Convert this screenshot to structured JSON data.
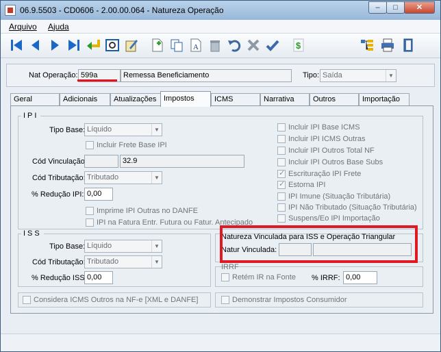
{
  "window": {
    "title": "06.9.5503 - CD0606 - 2.00.00.064 - Natureza Operação",
    "minimize": "–",
    "maximize": "□",
    "close": "✕"
  },
  "menu": [
    "Arquivo",
    "Ajuda"
  ],
  "toolbar": {
    "icons": [
      "first-icon",
      "prev-icon",
      "next-icon",
      "last-icon",
      "return-icon",
      "zoom-icon",
      "edit-icon",
      "new-icon",
      "copy-icon",
      "text-icon",
      "delete-icon",
      "undo-icon",
      "cancel-icon",
      "confirm-icon",
      "money-icon",
      "tree-icon",
      "print-icon",
      "exit-icon"
    ]
  },
  "header": {
    "nat_label": "Nat Operação:",
    "nat_value": "599a",
    "nat_desc": "Remessa Beneficiamento",
    "tipo_label": "Tipo:",
    "tipo_value": "Saída"
  },
  "tabs": [
    "Geral",
    "Adicionais",
    "Atualizações",
    "Impostos",
    "ICMS",
    "Narrativa",
    "Outros",
    "Importação"
  ],
  "ipi": {
    "title": "IPI",
    "tipo_base_label": "Tipo Base:",
    "tipo_base_value": "Líquido",
    "incluir_frete": "Incluir Frete Base IPI",
    "cod_vinc_label": "Cód Vinculação:",
    "cod_vinc_value": "32.9",
    "cod_trib_label": "Cód Tributação:",
    "cod_trib_value": "Tributado",
    "reducao_label": "% Redução IPI:",
    "reducao_value": "0,00",
    "imprime": "Imprime IPI Outras no DANFE",
    "ipi_fatura": "IPI na Fatura Entr. Futura ou Fatur. Antecipado",
    "right_checks": [
      "Incluir IPI Base ICMS",
      "Incluir IPI ICMS Outras",
      "Incluir IPI Outros Total NF",
      "Incluir IPI Outros Base Subs",
      "Escrituração IPI Frete",
      "Estorna IPI",
      "IPI Imune (Situação Tributária)",
      "IPI Não Tributado (Situação Tributária)",
      "Suspens/Eo IPI Importação"
    ]
  },
  "iss": {
    "title": "ISS",
    "tipo_base_label": "Tipo Base:",
    "tipo_base_value": "Líquido",
    "cod_trib_label": "Cód Tributação:",
    "cod_trib_value": "Tributado",
    "reducao_label": "% Redução ISS:",
    "reducao_value": "0,00"
  },
  "natureza": {
    "title": "Natureza Vinculada para ISS e Operação Triangular",
    "label": "Natur Vinculada:"
  },
  "irrf": {
    "title": "IRRF",
    "retem": "Retém IR na Fonte",
    "pct_label": "% IRRF:",
    "pct_value": "0,00"
  },
  "bottom": {
    "considera": "Considera ICMS Outros na NF-e [XML e DANFE]",
    "demonstrar": "Demonstrar Impostos Consumidor"
  },
  "colors": {
    "highlight": "#e01a24",
    "accent": "#1b68c7"
  }
}
